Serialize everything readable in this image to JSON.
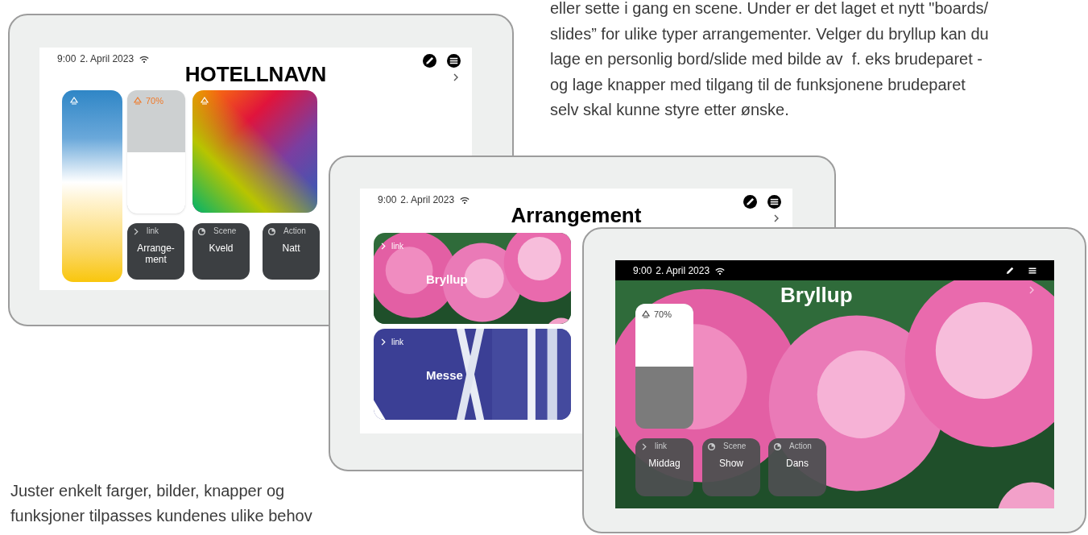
{
  "intro_text": "eller sette i gang en scene. Under er det laget et nytt \"boards/\nslides” for ulike typer arrangementer. Velger du bryllup kan du\nlage en personlig bord/slide med bilde av  f. eks brudeparet -\nog lage knapper med tilgang til de funksjonene brudeparet\nselv skal kunne styre etter ønske.",
  "tablets": [
    {
      "kind": "light",
      "status": {
        "time": "9:00",
        "date": "2. April 2023"
      },
      "title": "HOTELLNAVN",
      "tiles": [
        {
          "kind": "white_spectrum"
        },
        {
          "kind": "dimmer",
          "reading": "70%",
          "level": 0.5
        },
        {
          "kind": "color_field"
        }
      ],
      "buttons": [
        {
          "kind": "link",
          "label": "link",
          "name": "Arrange-ment"
        },
        {
          "kind": "scene",
          "label": "Scene",
          "name": "Kveld"
        },
        {
          "kind": "action",
          "label": "Action",
          "name": "Natt"
        }
      ]
    },
    {
      "kind": "light",
      "status": {
        "time": "9:00",
        "date": "2. April 2023"
      },
      "title": "Arrangement",
      "cards": [
        {
          "kind": "flowers",
          "label": "link",
          "name": "Bryllup"
        },
        {
          "kind": "stripes",
          "label": "link",
          "name": "Messe"
        }
      ]
    },
    {
      "status": {
        "time": "9:00",
        "date": "2. April 2023"
      },
      "title": "Bryllup",
      "tiles": [
        {
          "kind": "dimmer",
          "reading": "70%",
          "level": 0.5
        }
      ],
      "buttons": [
        {
          "kind": "link",
          "label": "link",
          "name": "Middag"
        },
        {
          "kind": "scene",
          "label": "Scene",
          "name": "Show"
        },
        {
          "kind": "action",
          "label": "Action",
          "name": "Dans"
        }
      ]
    }
  ],
  "caption": "Juster enkelt farger, bilder, knapper og\nfunksjoner tilpasses kundenes ulike behov"
}
